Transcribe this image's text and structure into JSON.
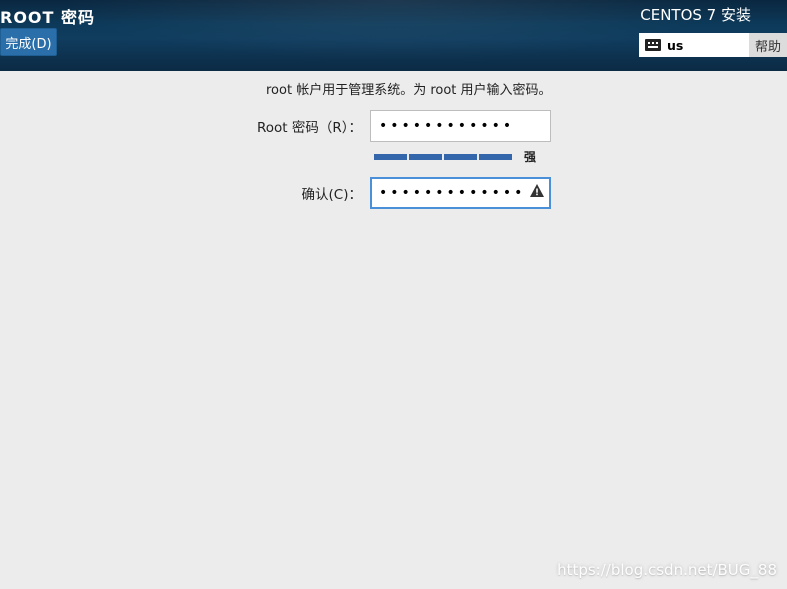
{
  "header": {
    "title": "ROOT 密码",
    "done_label": "完成(D)",
    "installer_name": "CENTOS 7 安装",
    "language_code": "us",
    "help_label": "帮助"
  },
  "form": {
    "description": "root 帐户用于管理系统。为 root 用户输入密码。",
    "password_label": "Root 密码（R）：",
    "password_value": "••••••••••••",
    "confirm_label": "确认(C)：",
    "confirm_value": "•••••••••••••",
    "strength_label": "强",
    "strength_segments": 4,
    "strength_filled": 4
  },
  "watermark": "https://blog.csdn.net/BUG_88"
}
